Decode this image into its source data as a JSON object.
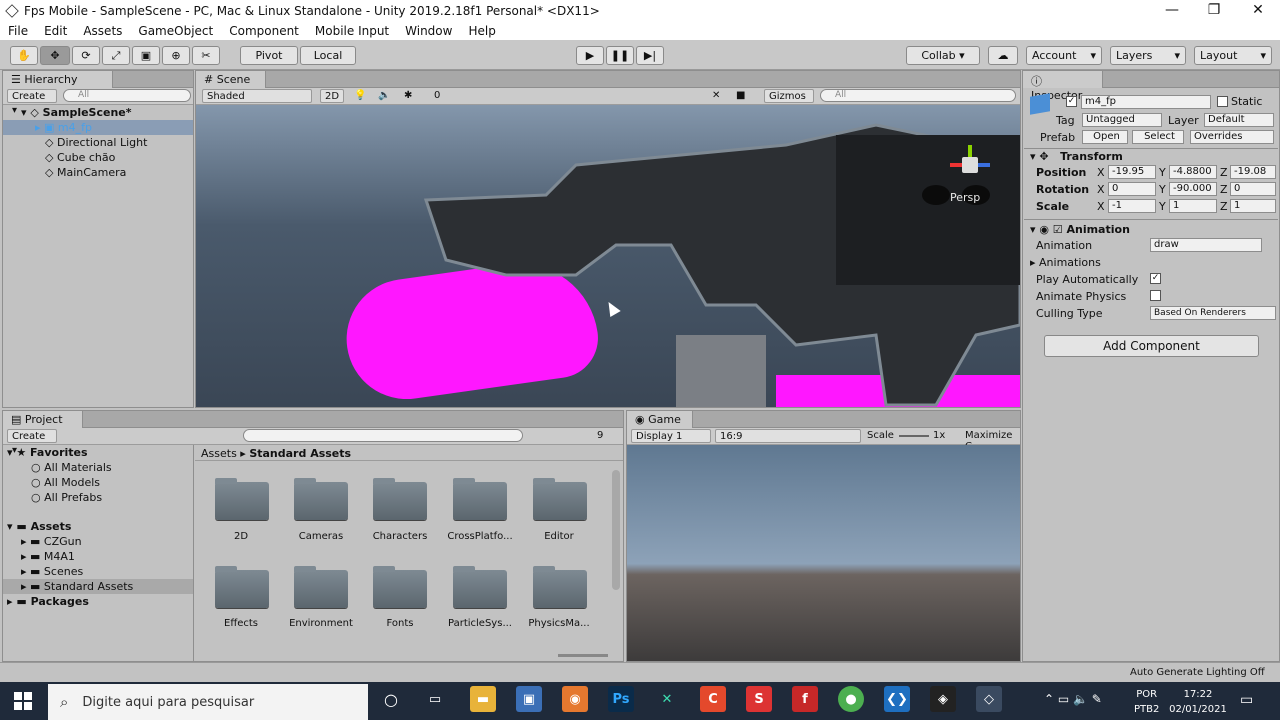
{
  "window": {
    "title": "Fps Mobile - SampleScene - PC, Mac & Linux Standalone - Unity 2019.2.18f1 Personal* <DX11>"
  },
  "menu": [
    "File",
    "Edit",
    "Assets",
    "GameObject",
    "Component",
    "Mobile Input",
    "Window",
    "Help"
  ],
  "toolbar": {
    "pivot": "Pivot",
    "local": "Local",
    "collab": "Collab ▾",
    "account": "Account",
    "layers": "Layers",
    "layout": "Layout"
  },
  "hierarchy": {
    "tab": "Hierarchy",
    "create": "Create ▾",
    "search_placeholder": "All",
    "scene": "SampleScene*",
    "items": [
      "m4_fp",
      "Directional Light",
      "Cube chão",
      "MainCamera"
    ]
  },
  "scene": {
    "tab": "Scene",
    "shading": "Shaded",
    "mode_2d": "2D",
    "fx_count": "0",
    "gizmos": "Gizmos",
    "search_placeholder": "All",
    "persp": "Persp"
  },
  "inspector": {
    "tab": "Inspector",
    "object_name": "m4_fp",
    "static_label": "Static",
    "tag_label": "Tag",
    "tag_value": "Untagged",
    "layer_label": "Layer",
    "layer_value": "Default",
    "prefab_label": "Prefab",
    "open": "Open",
    "select": "Select",
    "overrides": "Overrides",
    "transform": {
      "title": "Transform",
      "position_label": "Position",
      "rotation_label": "Rotation",
      "scale_label": "Scale",
      "pos": [
        "-19.95",
        "-4.8800",
        "-19.08"
      ],
      "rot": [
        "0",
        "-90.000",
        "0"
      ],
      "scl": [
        "-1",
        "1",
        "1"
      ]
    },
    "animation": {
      "title": "Animation",
      "animation_label": "Animation",
      "animation_value": "draw",
      "animations_label": "Animations",
      "play_auto": "Play Automatically",
      "animate_physics": "Animate Physics",
      "culling": "Culling Type",
      "culling_value": "Based On Renderers"
    },
    "add_component": "Add Component"
  },
  "project": {
    "tab": "Project",
    "create": "Create ▾",
    "count": "9",
    "favorites": {
      "title": "Favorites",
      "items": [
        "All Materials",
        "All Models",
        "All Prefabs"
      ]
    },
    "assets": {
      "title": "Assets",
      "items": [
        "CZGun",
        "M4A1",
        "Scenes",
        "Standard Assets"
      ]
    },
    "packages": "Packages",
    "breadcrumb": [
      "Assets",
      "Standard Assets"
    ],
    "folders": [
      "2D",
      "Cameras",
      "Characters",
      "CrossPlatfo...",
      "Editor",
      "Effects",
      "Environment",
      "Fonts",
      "ParticleSys...",
      "PhysicsMa..."
    ]
  },
  "game": {
    "tab": "Game",
    "display": "Display 1",
    "aspect": "16:9",
    "scale_label": "Scale",
    "scale_value": "1x",
    "maximize": "Maximize C"
  },
  "statusbar": {
    "text": "Auto Generate Lighting Off"
  },
  "taskbar": {
    "search": "Digite aqui para pesquisar",
    "lang1": "POR",
    "lang2": "PTB2",
    "time": "17:22",
    "date": "02/01/2021"
  }
}
